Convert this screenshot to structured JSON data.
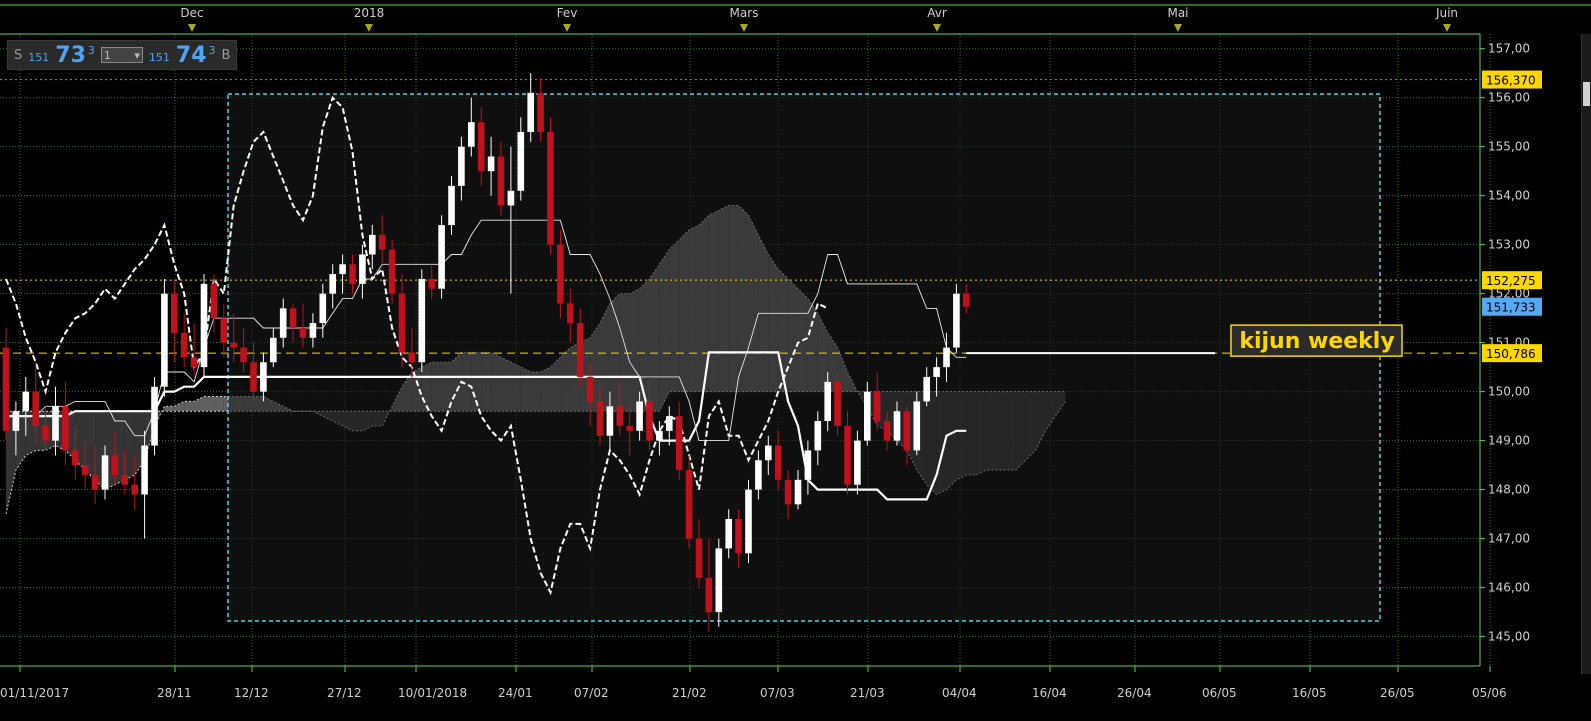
{
  "quote": {
    "sell_label": "S",
    "sell_base": "151",
    "sell_big": "73",
    "sell_sup": "3",
    "qty_value": "1",
    "buy_base": "151",
    "buy_big": "74",
    "buy_sup": "3",
    "buy_label": "B"
  },
  "colors": {
    "grid": "#5cd65c",
    "bull": "#ffffff",
    "bear": "#c0121c",
    "cloud_dark": "#3a3a3a",
    "cloud_light": "#6a6a6a",
    "highlight_box": "#4fd6e8",
    "label_yellow": "#ffd700",
    "label_blue": "#58a9f4"
  },
  "chart_data": {
    "type": "candlestick",
    "title": "",
    "ylim": [
      144.4,
      157.3
    ],
    "y_ticks": [
      "157,00",
      "156,00",
      "155,00",
      "154,00",
      "153,00",
      "152,00",
      "151,00",
      "150,00",
      "149,00",
      "148,00",
      "147,00",
      "146,00",
      "145,00"
    ],
    "x_tick_labels": [
      "01/11/2017",
      "28/11",
      "12/12",
      "27/12",
      "10/01/2018",
      "24/01",
      "07/02",
      "21/02",
      "07/03",
      "21/03",
      "04/04",
      "16/04",
      "26/04",
      "06/05",
      "16/05",
      "26/05",
      "05/06"
    ],
    "month_labels": [
      "Dec",
      "2018",
      "Fev",
      "Mars",
      "Avr",
      "Mai",
      "Juin"
    ],
    "price_labels": [
      {
        "label": "156,370",
        "value": 156.37,
        "style": "yellow"
      },
      {
        "label": "152,275",
        "value": 152.275,
        "style": "yellow"
      },
      {
        "label": "151,733",
        "value": 151.733,
        "style": "blue"
      },
      {
        "label": "150,786",
        "value": 150.786,
        "style": "yellow"
      }
    ],
    "annotation": "kijun weekly",
    "candles": [
      [
        150.9,
        151.3,
        149.0,
        149.2
      ],
      [
        149.2,
        149.8,
        148.7,
        149.6
      ],
      [
        149.6,
        150.3,
        149.1,
        150.0
      ],
      [
        150.0,
        150.6,
        148.9,
        149.3
      ],
      [
        149.3,
        149.7,
        148.8,
        149.0
      ],
      [
        149.0,
        150.1,
        148.7,
        149.7
      ],
      [
        149.7,
        150.2,
        148.5,
        148.8
      ],
      [
        148.8,
        149.3,
        148.2,
        148.5
      ],
      [
        148.5,
        149.0,
        148.0,
        148.3
      ],
      [
        148.3,
        148.9,
        147.7,
        148.0
      ],
      [
        148.0,
        148.9,
        147.8,
        148.7
      ],
      [
        148.7,
        149.2,
        148.1,
        148.3
      ],
      [
        148.3,
        148.8,
        147.9,
        148.1
      ],
      [
        148.1,
        148.7,
        147.6,
        147.9
      ],
      [
        147.9,
        149.2,
        147.0,
        148.9
      ],
      [
        148.9,
        150.3,
        148.7,
        150.1
      ],
      [
        150.1,
        152.3,
        149.9,
        152.0
      ],
      [
        152.0,
        152.3,
        150.6,
        151.2
      ],
      [
        151.2,
        151.6,
        150.5,
        150.7
      ],
      [
        150.7,
        151.4,
        150.3,
        150.5
      ],
      [
        150.5,
        152.4,
        150.3,
        152.2
      ],
      [
        152.2,
        152.4,
        151.2,
        151.5
      ],
      [
        151.5,
        151.8,
        150.7,
        151.0
      ],
      [
        151.0,
        151.6,
        150.6,
        150.9
      ],
      [
        150.9,
        151.3,
        150.4,
        150.6
      ],
      [
        150.6,
        151.0,
        149.8,
        150.0
      ],
      [
        150.0,
        150.8,
        149.8,
        150.6
      ],
      [
        150.6,
        151.3,
        150.5,
        151.1
      ],
      [
        151.1,
        151.9,
        150.9,
        151.7
      ],
      [
        151.7,
        151.8,
        151.0,
        151.3
      ],
      [
        151.3,
        151.8,
        150.9,
        151.1
      ],
      [
        151.1,
        151.6,
        150.9,
        151.4
      ],
      [
        151.4,
        152.2,
        151.1,
        152.0
      ],
      [
        152.0,
        152.6,
        151.7,
        152.4
      ],
      [
        152.4,
        152.8,
        152.0,
        152.6
      ],
      [
        152.6,
        152.8,
        152.0,
        152.2
      ],
      [
        152.2,
        153.0,
        151.9,
        152.8
      ],
      [
        152.8,
        153.4,
        152.5,
        153.2
      ],
      [
        153.2,
        153.6,
        152.6,
        152.9
      ],
      [
        152.9,
        153.1,
        151.8,
        152.0
      ],
      [
        152.0,
        152.4,
        150.5,
        150.8
      ],
      [
        150.8,
        151.3,
        150.2,
        150.6
      ],
      [
        150.6,
        152.5,
        150.4,
        152.3
      ],
      [
        152.3,
        152.6,
        151.9,
        152.1
      ],
      [
        152.1,
        153.6,
        151.9,
        153.4
      ],
      [
        153.4,
        154.4,
        153.2,
        154.2
      ],
      [
        154.2,
        155.2,
        153.9,
        155.0
      ],
      [
        155.0,
        156.0,
        154.8,
        155.5
      ],
      [
        155.5,
        155.8,
        154.2,
        154.5
      ],
      [
        154.5,
        155.2,
        154.0,
        154.8
      ],
      [
        154.8,
        155.1,
        153.6,
        153.8
      ],
      [
        153.8,
        155.0,
        152.0,
        154.1
      ],
      [
        154.1,
        155.6,
        153.9,
        155.3
      ],
      [
        155.3,
        156.5,
        155.1,
        156.1
      ],
      [
        156.1,
        156.4,
        155.1,
        155.3
      ],
      [
        155.3,
        155.6,
        152.8,
        153.0
      ],
      [
        153.0,
        153.3,
        151.5,
        151.8
      ],
      [
        151.8,
        152.1,
        151.0,
        151.4
      ],
      [
        151.4,
        151.7,
        150.1,
        150.3
      ],
      [
        150.3,
        150.6,
        149.3,
        149.8
      ],
      [
        149.8,
        150.1,
        148.9,
        149.1
      ],
      [
        149.1,
        150.0,
        148.8,
        149.7
      ],
      [
        149.7,
        150.2,
        149.1,
        149.3
      ],
      [
        149.3,
        149.8,
        148.7,
        149.2
      ],
      [
        149.2,
        150.0,
        149.0,
        149.8
      ],
      [
        149.8,
        150.3,
        148.8,
        149.0
      ],
      [
        149.0,
        149.4,
        148.7,
        149.2
      ],
      [
        149.2,
        149.7,
        148.9,
        149.5
      ],
      [
        149.5,
        149.8,
        148.2,
        148.4
      ],
      [
        148.4,
        148.7,
        146.8,
        147.0
      ],
      [
        147.0,
        147.4,
        146.0,
        146.2
      ],
      [
        146.2,
        147.0,
        145.1,
        145.5
      ],
      [
        145.5,
        147.0,
        145.2,
        146.8
      ],
      [
        146.8,
        147.6,
        146.6,
        147.4
      ],
      [
        147.4,
        147.6,
        146.4,
        146.7
      ],
      [
        146.7,
        148.2,
        146.5,
        148.0
      ],
      [
        148.0,
        148.8,
        147.8,
        148.6
      ],
      [
        148.6,
        149.1,
        148.3,
        148.9
      ],
      [
        148.9,
        149.2,
        148.0,
        148.2
      ],
      [
        148.2,
        148.4,
        147.4,
        147.7
      ],
      [
        147.7,
        148.4,
        147.6,
        148.2
      ],
      [
        148.2,
        149.0,
        147.9,
        148.8
      ],
      [
        148.8,
        149.6,
        148.5,
        149.4
      ],
      [
        149.4,
        150.4,
        149.2,
        150.2
      ],
      [
        150.2,
        150.4,
        149.1,
        149.3
      ],
      [
        149.3,
        149.6,
        147.9,
        148.1
      ],
      [
        148.1,
        149.2,
        147.9,
        149.0
      ],
      [
        149.0,
        150.2,
        148.9,
        150.0
      ],
      [
        150.0,
        150.4,
        149.2,
        149.4
      ],
      [
        149.4,
        149.6,
        148.8,
        149.0
      ],
      [
        149.0,
        149.8,
        148.9,
        149.6
      ],
      [
        149.6,
        149.7,
        148.5,
        148.8
      ],
      [
        148.8,
        150.0,
        148.7,
        149.8
      ],
      [
        149.8,
        150.5,
        149.7,
        150.3
      ],
      [
        150.3,
        150.7,
        149.9,
        150.5
      ],
      [
        150.5,
        151.2,
        150.2,
        150.9
      ],
      [
        150.9,
        152.2,
        150.8,
        152.0
      ],
      [
        152.0,
        152.2,
        151.6,
        151.733
      ]
    ],
    "tenkan": [
      149.5,
      149.5,
      149.5,
      149.5,
      149.7,
      149.7,
      149.7,
      149.8,
      149.8,
      149.8,
      149.8,
      149.4,
      149.4,
      149.1,
      149.1,
      149.6,
      150.4,
      150.4,
      150.4,
      150.2,
      150.9,
      151.5,
      151.5,
      151.5,
      151.5,
      151.5,
      151.3,
      151.3,
      151.3,
      151.3,
      151.3,
      151.3,
      151.3,
      151.6,
      151.9,
      151.9,
      152.3,
      152.3,
      152.6,
      152.6,
      152.6,
      152.6,
      152.6,
      152.6,
      152.6,
      152.8,
      152.8,
      153.2,
      153.5,
      153.5,
      153.5,
      153.5,
      153.5,
      153.5,
      153.5,
      153.5,
      153.5,
      152.8,
      152.8,
      152.8,
      152.4,
      151.9,
      151.3,
      150.6,
      150.3,
      150.3,
      150.3,
      150.3,
      150.3,
      149.8,
      149.0,
      149.0,
      149.0,
      149.0,
      150.3,
      150.9,
      151.6,
      151.6,
      151.6,
      151.6,
      151.6,
      151.6,
      152.0,
      152.8,
      152.8,
      152.2,
      152.2,
      152.2,
      152.2,
      152.2,
      152.2,
      152.2,
      152.2,
      151.7,
      151.7,
      150.9,
      150.7,
      150.7
    ],
    "kijun": [
      149.5,
      149.5,
      149.5,
      149.5,
      149.5,
      149.5,
      149.5,
      149.6,
      149.6,
      149.6,
      149.6,
      149.6,
      149.6,
      149.6,
      149.6,
      149.6,
      150.0,
      150.0,
      150.1,
      150.1,
      150.3,
      150.3,
      150.3,
      150.3,
      150.3,
      150.3,
      150.3,
      150.3,
      150.3,
      150.3,
      150.3,
      150.3,
      150.3,
      150.3,
      150.3,
      150.3,
      150.3,
      150.3,
      150.3,
      150.3,
      150.3,
      150.3,
      150.3,
      150.3,
      150.3,
      150.3,
      150.3,
      150.3,
      150.3,
      150.3,
      150.3,
      150.3,
      150.3,
      150.3,
      150.3,
      150.3,
      150.3,
      150.3,
      150.3,
      150.3,
      150.3,
      150.3,
      150.3,
      150.3,
      150.3,
      149.5,
      149.0,
      149.0,
      149.0,
      149.0,
      149.4,
      150.8,
      150.8,
      150.8,
      150.8,
      150.8,
      150.8,
      150.8,
      150.8,
      149.8,
      149.3,
      148.2,
      148.0,
      148.0,
      148.0,
      148.0,
      148.0,
      148.0,
      148.0,
      147.8,
      147.8,
      147.8,
      147.8,
      147.8,
      148.3,
      149.1,
      149.2,
      149.2
    ],
    "chikou": [
      152.3,
      151.8,
      151.1,
      150.6,
      150.0,
      150.8,
      151.2,
      151.5,
      151.6,
      151.8,
      152.1,
      151.9,
      152.2,
      152.5,
      152.7,
      153.0,
      153.4,
      152.6,
      152.0,
      150.5,
      150.8,
      152.3,
      152.0,
      153.8,
      154.5,
      155.1,
      155.3,
      154.8,
      154.3,
      153.8,
      153.5,
      154.0,
      155.4,
      156.0,
      155.8,
      154.9,
      153.2,
      152.3,
      152.5,
      151.3,
      150.7,
      150.5,
      149.9,
      149.5,
      149.2,
      149.8,
      150.2,
      150.1,
      149.5,
      149.2,
      149.0,
      149.3,
      148.2,
      147.0,
      146.3,
      145.9,
      146.8,
      147.3,
      147.3,
      146.8,
      148.0,
      148.8,
      148.6,
      148.3,
      147.9,
      148.6,
      149.2,
      149.5,
      149.4,
      148.7,
      148.0,
      149.5,
      149.8,
      149.1,
      149.1,
      148.6,
      149.0,
      149.4,
      150.0,
      150.5,
      151.0,
      151.1,
      151.8,
      151.7
    ],
    "span_a": [
      147.5,
      148.4,
      148.7,
      148.8,
      148.8,
      148.9,
      148.8,
      148.6,
      148.4,
      148.2,
      148.0,
      148.1,
      148.2,
      148.3,
      148.6,
      149.3,
      149.7,
      149.7,
      149.8,
      149.8,
      149.9,
      149.9,
      149.9,
      149.9,
      149.9,
      149.9,
      149.9,
      149.8,
      149.7,
      149.6,
      149.6,
      149.6,
      149.5,
      149.4,
      149.3,
      149.2,
      149.2,
      149.3,
      149.3,
      149.7,
      150.1,
      150.4,
      150.5,
      150.6,
      150.6,
      150.6,
      150.8,
      150.8,
      150.8,
      150.8,
      150.7,
      150.6,
      150.5,
      150.4,
      150.4,
      150.5,
      150.7,
      150.9,
      151.0,
      151.1,
      151.4,
      151.8,
      152.0,
      152.0,
      152.1,
      152.3,
      152.6,
      152.9,
      153.1,
      153.3,
      153.4,
      153.6,
      153.7,
      153.8,
      153.8,
      153.6,
      153.2,
      152.8,
      152.5,
      152.3,
      152.1,
      151.9,
      151.6,
      151.2,
      150.9,
      150.4,
      150.0,
      149.7,
      149.3,
      149.2,
      149.0,
      148.8,
      148.4,
      148.1,
      147.9,
      148.0,
      148.2,
      148.3,
      148.3,
      148.4,
      148.4,
      148.4,
      148.4,
      148.6,
      148.8,
      149.2,
      149.5,
      149.8
    ],
    "span_b": [
      149.6,
      149.6,
      149.6,
      149.6,
      149.6,
      149.6,
      149.6,
      149.6,
      149.6,
      149.6,
      149.6,
      149.6,
      149.6,
      149.6,
      149.6,
      149.6,
      149.6,
      149.6,
      149.6,
      149.6,
      149.6,
      149.6,
      149.6,
      149.6,
      149.6,
      149.6,
      149.6,
      149.6,
      149.6,
      149.6,
      149.6,
      149.6,
      149.6,
      149.6,
      149.6,
      149.6,
      149.6,
      149.6,
      149.6,
      149.6,
      149.6,
      149.6,
      149.6,
      149.6,
      149.6,
      149.6,
      149.6,
      149.6,
      149.6,
      149.6,
      149.6,
      149.6,
      149.6,
      149.6,
      149.6,
      149.6,
      149.6,
      149.6,
      149.6,
      149.6,
      149.6,
      149.6,
      149.6,
      149.6,
      149.6,
      149.6,
      149.6,
      150.0,
      150.0,
      150.0,
      150.0,
      150.0,
      150.0,
      150.0,
      150.0,
      150.0,
      150.0,
      150.0,
      150.0,
      150.0,
      150.0,
      150.0,
      150.0,
      150.0,
      150.0,
      150.0,
      150.0,
      150.0,
      150.0,
      150.0,
      150.0,
      150.0,
      150.0,
      150.0,
      150.0,
      150.0,
      150.0,
      150.0,
      150.0,
      150.0,
      150.0,
      150.0,
      150.0,
      150.0,
      150.0,
      150.0,
      150.0,
      150.0
    ]
  }
}
